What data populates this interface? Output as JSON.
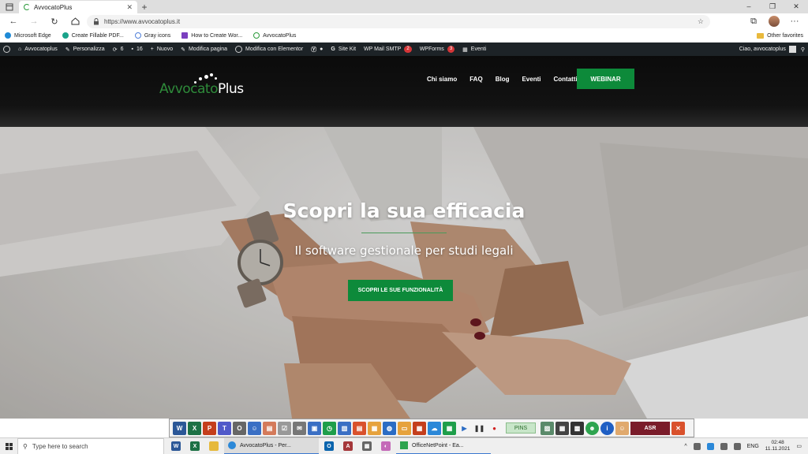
{
  "browser": {
    "tab_title": "AvvocatoPlus",
    "new_tab": "+",
    "url": "https://www.avvocatoplus.it",
    "window_controls": [
      "–",
      "❐",
      "✕"
    ]
  },
  "favorites": {
    "items": [
      {
        "label": "Microsoft Edge",
        "color": "#1f8ad6"
      },
      {
        "label": "Create Fillable PDF...",
        "color": "#1aa38a"
      },
      {
        "label": "Gray icons",
        "color": "#4f7fd9"
      },
      {
        "label": "How to Create Wor...",
        "color": "#7a3fbf"
      },
      {
        "label": "AvvocatoPlus",
        "color": "#2a9a3a"
      }
    ],
    "other": "Other favorites"
  },
  "wpbar": {
    "site": "Avvocatoplus",
    "customize": "Personalizza",
    "updates": "6",
    "comments": "16",
    "new": "Nuovo",
    "edit_page": "Modifica pagina",
    "edit_elementor": "Modifica con Elementor",
    "site_kit": "Site Kit",
    "mail_smtp": "WP Mail SMTP",
    "mail_smtp_badge": "2",
    "wpforms": "WPForms",
    "wpforms_badge": "3",
    "events": "Eventi",
    "greeting": "Ciao, avvocatoplus"
  },
  "site": {
    "logo_text_a": "Avvocato",
    "logo_text_b": "Plus",
    "menu": [
      "Chi siamo",
      "FAQ",
      "Blog",
      "Eventi",
      "Contatti"
    ],
    "webinar": "WEBINAR",
    "accent": "#0d8a3a"
  },
  "hero": {
    "title": "Scopri la sua efficacia",
    "subtitle": "Il software gestionale per studi legali",
    "cta": "SCOPRI LE SUE FUNZIONALITÀ"
  },
  "apptoolbar": {
    "pins": "PINS",
    "asr": "ASR"
  },
  "taskbar": {
    "search_placeholder": "Type here to search",
    "window1": "AvvocatoPlus - Per...",
    "window2": "OfficeNetPoint - Ea...",
    "lang": "ENG",
    "time": "02:48",
    "date": "11.11.2021"
  }
}
